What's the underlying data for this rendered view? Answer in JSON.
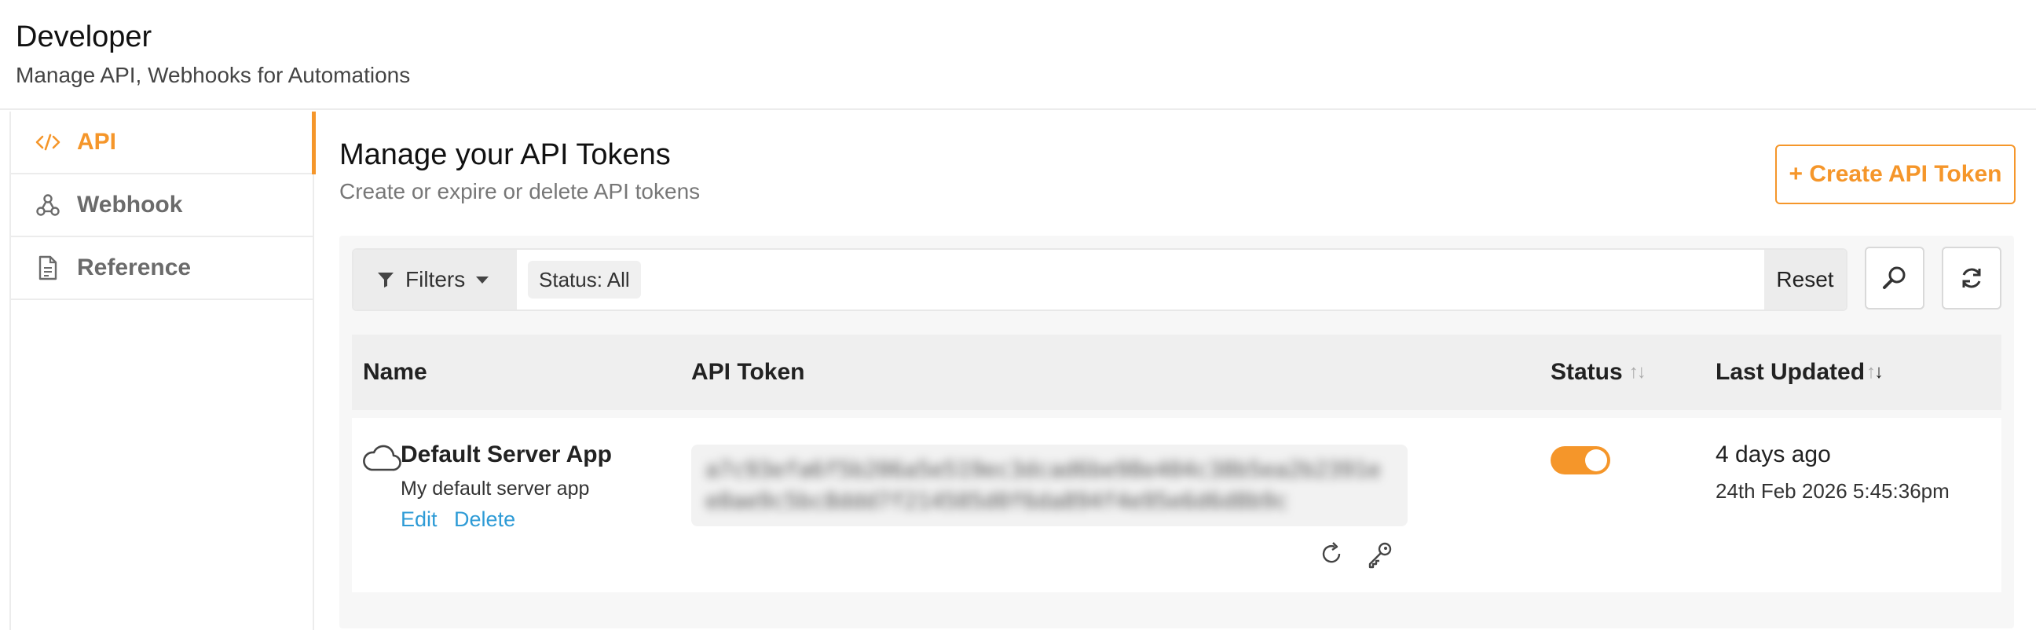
{
  "header": {
    "title": "Developer",
    "subtitle": "Manage API, Webhooks for Automations"
  },
  "sidebar": {
    "items": [
      {
        "label": "API",
        "icon": "code-icon",
        "active": true
      },
      {
        "label": "Webhook",
        "icon": "webhook-icon",
        "active": false
      },
      {
        "label": "Reference",
        "icon": "document-icon",
        "active": false
      }
    ]
  },
  "main": {
    "title": "Manage your API Tokens",
    "subtitle": "Create or expire or delete API tokens",
    "create_button": "+ Create API Token"
  },
  "filters": {
    "button_label": "Filters",
    "chip": "Status: All",
    "reset_label": "Reset"
  },
  "table": {
    "columns": [
      "Name",
      "API Token",
      "Status",
      "Last Updated"
    ],
    "rows": [
      {
        "name": "Default Server App",
        "description": "My default server app",
        "edit_label": "Edit",
        "delete_label": "Delete",
        "token": "a7c93efa6f5b206a5e519ec3dcad6be98e404c38b5ea2b2391ee0ae9c5bc8ddd7f214505d0f6da894f4e95e6d6d8b9c",
        "status_enabled": true,
        "updated_relative": "4 days ago",
        "updated_absolute": "24th Feb 2026 5:45:36pm"
      }
    ]
  },
  "colors": {
    "accent": "#f5962a",
    "link": "#2e9bd6"
  }
}
